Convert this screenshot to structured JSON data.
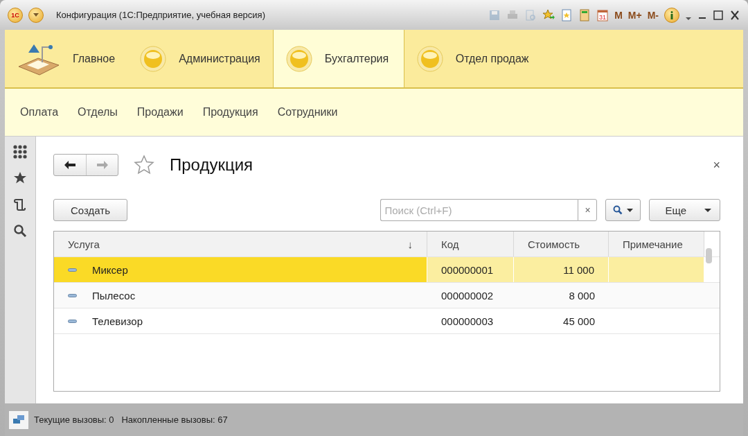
{
  "window": {
    "logo": "1С",
    "title": "Конфигурация  (1С:Предприятие, учебная версия)",
    "toolbar": [
      {
        "kind": "save",
        "disabled": true
      },
      {
        "kind": "print",
        "disabled": true
      },
      {
        "kind": "preview",
        "disabled": true
      },
      {
        "kind": "favorite-add",
        "disabled": false
      },
      {
        "kind": "favorite-doc",
        "disabled": false
      },
      {
        "kind": "calculator",
        "disabled": false
      },
      {
        "kind": "calendar",
        "text": "31",
        "disabled": false
      },
      {
        "kind": "memory",
        "text": "M",
        "disabled": false
      },
      {
        "kind": "memory",
        "text": "M+",
        "disabled": false
      },
      {
        "kind": "memory",
        "text": "M-",
        "disabled": false
      },
      {
        "kind": "info",
        "disabled": false
      }
    ]
  },
  "sections": [
    {
      "label": "Главное",
      "kind": "home",
      "selected": false
    },
    {
      "label": "Администрация",
      "kind": "ball",
      "selected": false
    },
    {
      "label": "Бухгалтерия",
      "kind": "ball",
      "selected": true
    },
    {
      "label": "Отдел продаж",
      "kind": "ball",
      "selected": false
    }
  ],
  "subsections": [
    "Оплата",
    "Отделы",
    "Продажи",
    "Продукция",
    "Сотрудники"
  ],
  "sidebar": [
    {
      "kind": "apps"
    },
    {
      "kind": "star"
    },
    {
      "kind": "history"
    },
    {
      "kind": "search"
    }
  ],
  "form": {
    "title": "Продукция",
    "close": "×",
    "create_button": "Создать",
    "search": {
      "placeholder": "Поиск (Ctrl+F)",
      "clear": "×"
    },
    "more_button": "Еще",
    "table": {
      "columns": [
        {
          "label": "Услуга",
          "sorted": true
        },
        {
          "label": "Код",
          "sorted": false
        },
        {
          "label": "Стоимость",
          "sorted": false
        },
        {
          "label": "Примечание",
          "sorted": false
        }
      ],
      "sort_mark": "↓",
      "rows": [
        {
          "cells": [
            "Миксер",
            "000000001",
            "11 000",
            ""
          ],
          "selected": true
        },
        {
          "cells": [
            "Пылесос",
            "000000002",
            "8 000",
            ""
          ],
          "selected": false
        },
        {
          "cells": [
            "Телевизор",
            "000000003",
            "45 000",
            ""
          ],
          "selected": false
        }
      ]
    }
  },
  "status_bar": {
    "text": "Текущие вызовы: 0   Накопленные вызовы: 67"
  }
}
